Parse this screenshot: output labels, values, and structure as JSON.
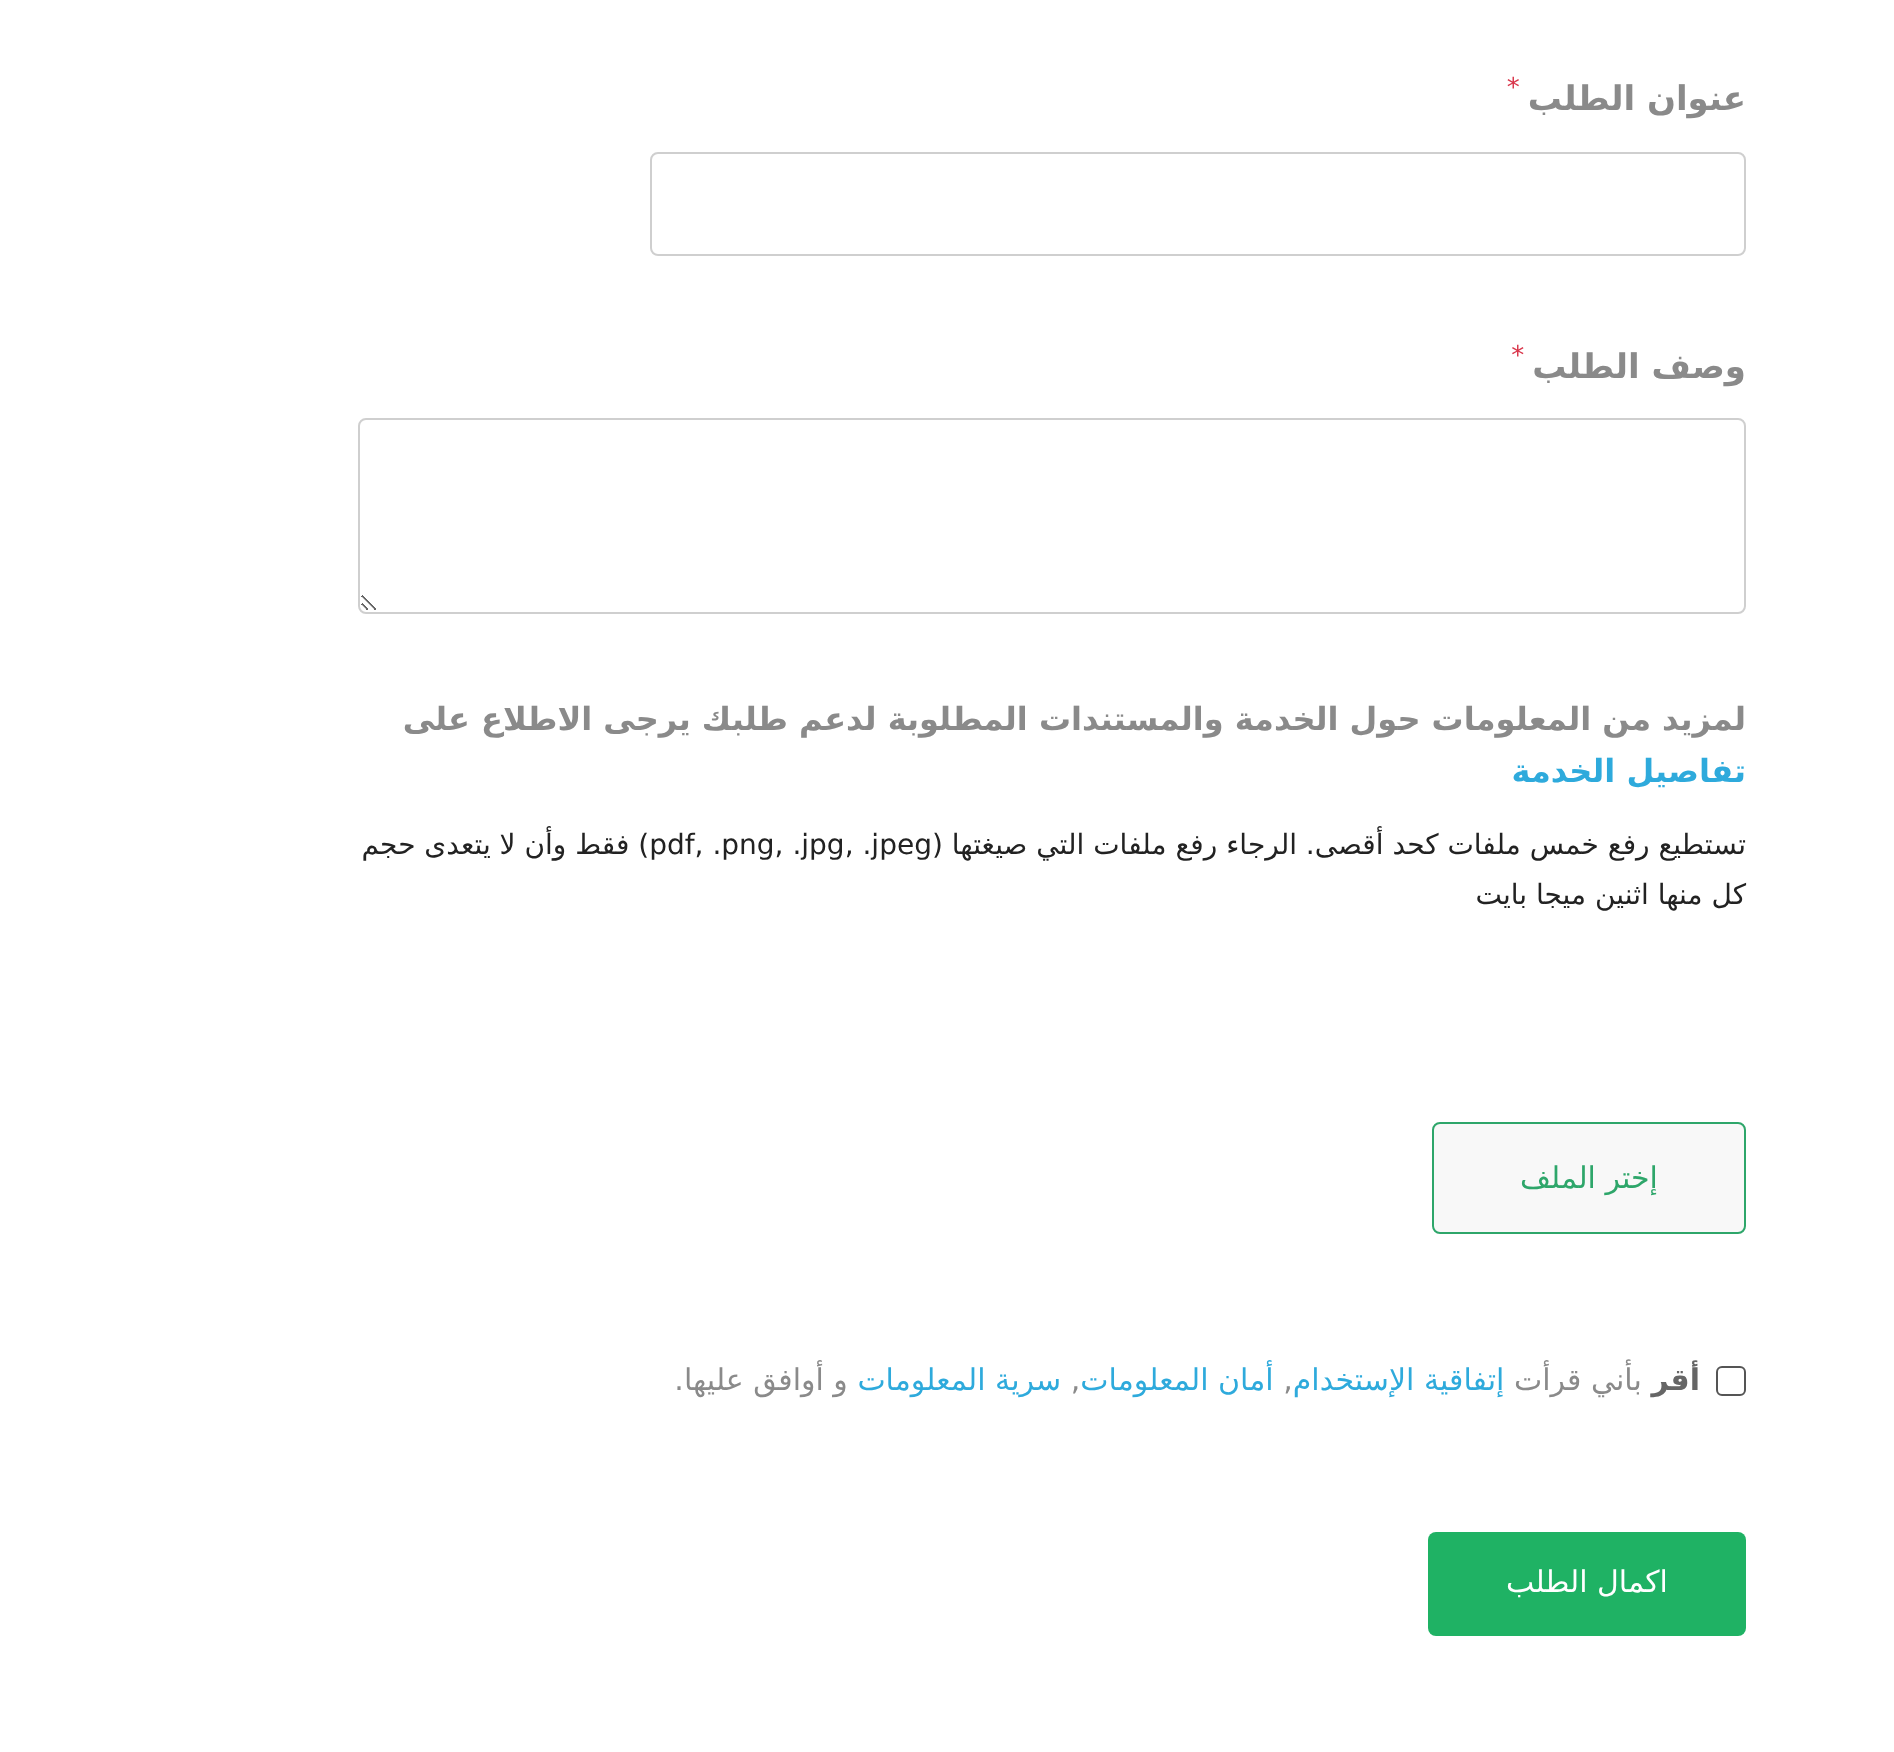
{
  "fields": [
    {
      "kind": "input",
      "label": "عنوان الطلب",
      "required_mark": "*"
    },
    {
      "kind": "textarea",
      "label": "وصف الطلب",
      "required_mark": "*"
    }
  ],
  "info": {
    "text": "لمزيد من المعلومات حول الخدمة والمستندات المطلوبة لدعم طلبك يرجى الاطلاع على",
    "link": "تفاصيل الخدمة"
  },
  "upload_note": "تستطيع رفع خمس ملفات كحد أقصى. الرجاء رفع ملفات التي صيغتها (pdf, .png, .jpg, .jpeg) فقط وأن لا يتعدى حجم كل منها اثنين ميجا بايت",
  "file_button": "إختر الملف",
  "consent": {
    "checked": false,
    "lead": "أقر",
    "before": "بأني قرأت",
    "links": [
      "إتفاقية الإستخدام",
      "أمان المعلومات",
      "سرية المعلومات"
    ],
    "separator": ",",
    "after": "و أوافق عليها."
  },
  "submit_button": "اكمال الطلب"
}
